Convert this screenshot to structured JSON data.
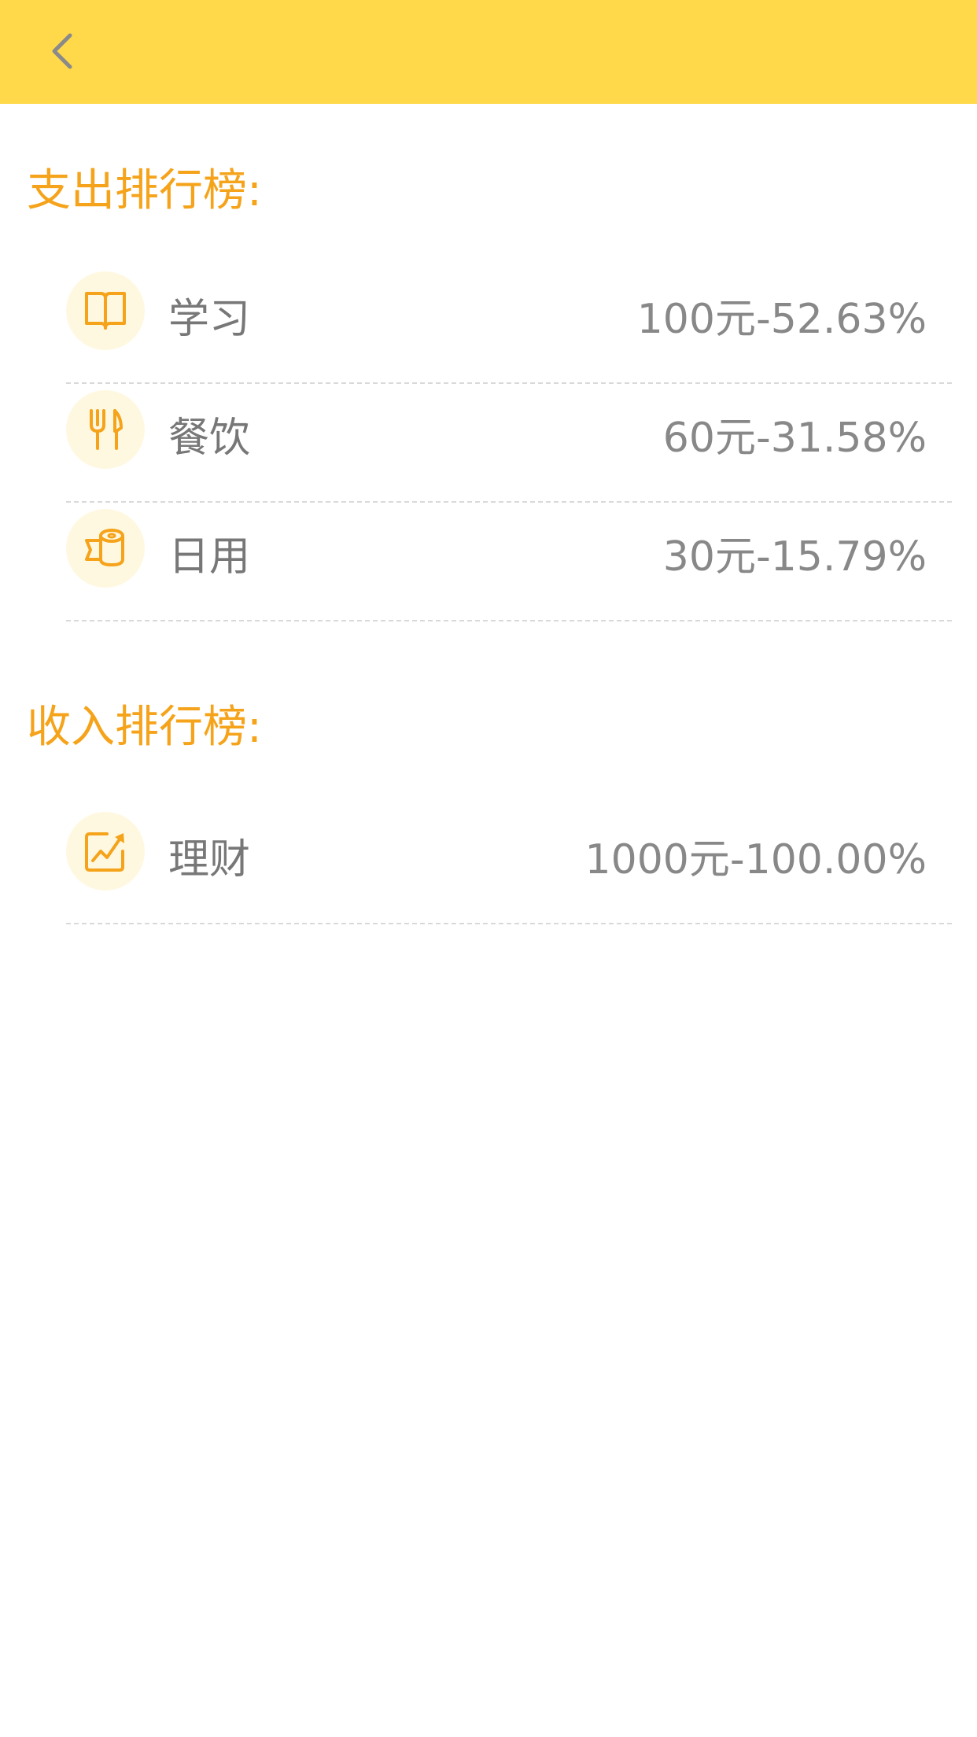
{
  "header": {
    "back_icon": "chevron-left-icon",
    "background_color": "#FFD94A"
  },
  "colors": {
    "accent": "#F5A31A",
    "icon_bg": "#FFF8E1",
    "text": "#777777",
    "divider": "#d9d9d9"
  },
  "expense": {
    "title": "支出排行榜:",
    "items": [
      {
        "icon": "book-icon",
        "label": "学习",
        "value": "100元-52.63%"
      },
      {
        "icon": "fork-knife-icon",
        "label": "餐饮",
        "value": "60元-31.58%"
      },
      {
        "icon": "tissue-roll-icon",
        "label": "日用",
        "value": "30元-15.79%"
      }
    ]
  },
  "income": {
    "title": "收入排行榜:",
    "items": [
      {
        "icon": "trend-chart-icon",
        "label": "理财",
        "value": "1000元-100.00%"
      }
    ]
  }
}
